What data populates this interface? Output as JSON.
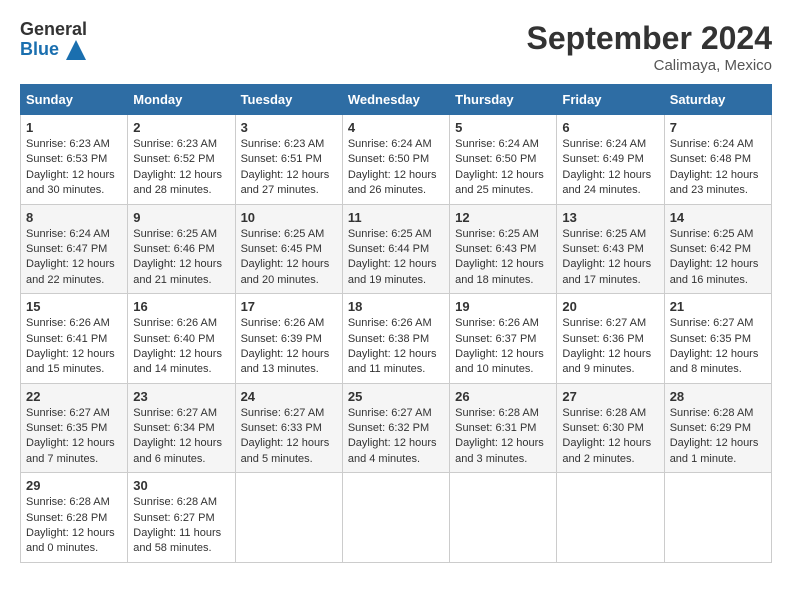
{
  "logo": {
    "text_general": "General",
    "text_blue": "Blue"
  },
  "title": "September 2024",
  "location": "Calimaya, Mexico",
  "days_of_week": [
    "Sunday",
    "Monday",
    "Tuesday",
    "Wednesday",
    "Thursday",
    "Friday",
    "Saturday"
  ],
  "weeks": [
    [
      {
        "day": "1",
        "sunrise": "6:23 AM",
        "sunset": "6:53 PM",
        "daylight": "12 hours and 30 minutes."
      },
      {
        "day": "2",
        "sunrise": "6:23 AM",
        "sunset": "6:52 PM",
        "daylight": "12 hours and 28 minutes."
      },
      {
        "day": "3",
        "sunrise": "6:23 AM",
        "sunset": "6:51 PM",
        "daylight": "12 hours and 27 minutes."
      },
      {
        "day": "4",
        "sunrise": "6:24 AM",
        "sunset": "6:50 PM",
        "daylight": "12 hours and 26 minutes."
      },
      {
        "day": "5",
        "sunrise": "6:24 AM",
        "sunset": "6:50 PM",
        "daylight": "12 hours and 25 minutes."
      },
      {
        "day": "6",
        "sunrise": "6:24 AM",
        "sunset": "6:49 PM",
        "daylight": "12 hours and 24 minutes."
      },
      {
        "day": "7",
        "sunrise": "6:24 AM",
        "sunset": "6:48 PM",
        "daylight": "12 hours and 23 minutes."
      }
    ],
    [
      {
        "day": "8",
        "sunrise": "6:24 AM",
        "sunset": "6:47 PM",
        "daylight": "12 hours and 22 minutes."
      },
      {
        "day": "9",
        "sunrise": "6:25 AM",
        "sunset": "6:46 PM",
        "daylight": "12 hours and 21 minutes."
      },
      {
        "day": "10",
        "sunrise": "6:25 AM",
        "sunset": "6:45 PM",
        "daylight": "12 hours and 20 minutes."
      },
      {
        "day": "11",
        "sunrise": "6:25 AM",
        "sunset": "6:44 PM",
        "daylight": "12 hours and 19 minutes."
      },
      {
        "day": "12",
        "sunrise": "6:25 AM",
        "sunset": "6:43 PM",
        "daylight": "12 hours and 18 minutes."
      },
      {
        "day": "13",
        "sunrise": "6:25 AM",
        "sunset": "6:43 PM",
        "daylight": "12 hours and 17 minutes."
      },
      {
        "day": "14",
        "sunrise": "6:25 AM",
        "sunset": "6:42 PM",
        "daylight": "12 hours and 16 minutes."
      }
    ],
    [
      {
        "day": "15",
        "sunrise": "6:26 AM",
        "sunset": "6:41 PM",
        "daylight": "12 hours and 15 minutes."
      },
      {
        "day": "16",
        "sunrise": "6:26 AM",
        "sunset": "6:40 PM",
        "daylight": "12 hours and 14 minutes."
      },
      {
        "day": "17",
        "sunrise": "6:26 AM",
        "sunset": "6:39 PM",
        "daylight": "12 hours and 13 minutes."
      },
      {
        "day": "18",
        "sunrise": "6:26 AM",
        "sunset": "6:38 PM",
        "daylight": "12 hours and 11 minutes."
      },
      {
        "day": "19",
        "sunrise": "6:26 AM",
        "sunset": "6:37 PM",
        "daylight": "12 hours and 10 minutes."
      },
      {
        "day": "20",
        "sunrise": "6:27 AM",
        "sunset": "6:36 PM",
        "daylight": "12 hours and 9 minutes."
      },
      {
        "day": "21",
        "sunrise": "6:27 AM",
        "sunset": "6:35 PM",
        "daylight": "12 hours and 8 minutes."
      }
    ],
    [
      {
        "day": "22",
        "sunrise": "6:27 AM",
        "sunset": "6:35 PM",
        "daylight": "12 hours and 7 minutes."
      },
      {
        "day": "23",
        "sunrise": "6:27 AM",
        "sunset": "6:34 PM",
        "daylight": "12 hours and 6 minutes."
      },
      {
        "day": "24",
        "sunrise": "6:27 AM",
        "sunset": "6:33 PM",
        "daylight": "12 hours and 5 minutes."
      },
      {
        "day": "25",
        "sunrise": "6:27 AM",
        "sunset": "6:32 PM",
        "daylight": "12 hours and 4 minutes."
      },
      {
        "day": "26",
        "sunrise": "6:28 AM",
        "sunset": "6:31 PM",
        "daylight": "12 hours and 3 minutes."
      },
      {
        "day": "27",
        "sunrise": "6:28 AM",
        "sunset": "6:30 PM",
        "daylight": "12 hours and 2 minutes."
      },
      {
        "day": "28",
        "sunrise": "6:28 AM",
        "sunset": "6:29 PM",
        "daylight": "12 hours and 1 minute."
      }
    ],
    [
      {
        "day": "29",
        "sunrise": "6:28 AM",
        "sunset": "6:28 PM",
        "daylight": "12 hours and 0 minutes."
      },
      {
        "day": "30",
        "sunrise": "6:28 AM",
        "sunset": "6:27 PM",
        "daylight": "11 hours and 58 minutes."
      },
      null,
      null,
      null,
      null,
      null
    ]
  ]
}
